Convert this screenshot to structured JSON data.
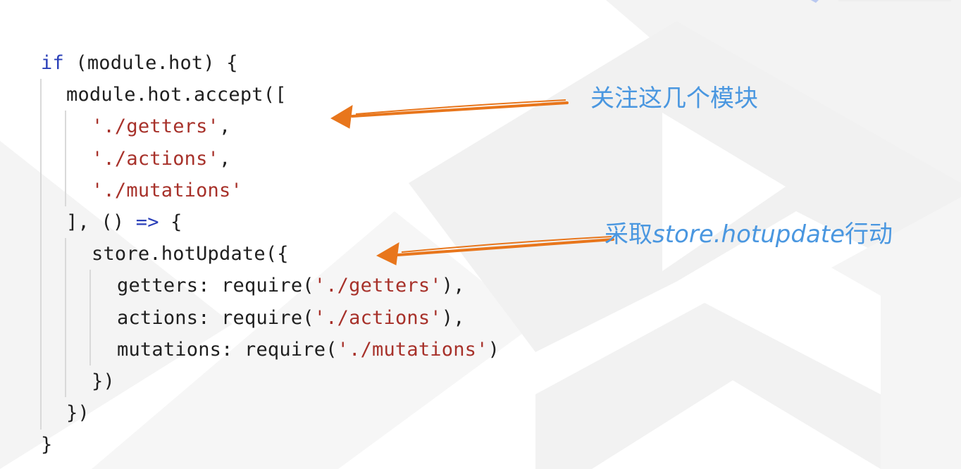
{
  "code": {
    "lines": [
      {
        "indent": 0,
        "tokens": [
          {
            "t": "if",
            "c": "kw"
          },
          {
            "t": " (module.hot) {",
            "c": ""
          }
        ]
      },
      {
        "indent": 1,
        "tokens": [
          {
            "t": "module.hot.accept([",
            "c": ""
          }
        ]
      },
      {
        "indent": 2,
        "tokens": [
          {
            "t": "'./getters'",
            "c": "str"
          },
          {
            "t": ",",
            "c": ""
          }
        ]
      },
      {
        "indent": 2,
        "tokens": [
          {
            "t": "'./actions'",
            "c": "str"
          },
          {
            "t": ",",
            "c": ""
          }
        ]
      },
      {
        "indent": 2,
        "tokens": [
          {
            "t": "'./mutations'",
            "c": "str"
          }
        ]
      },
      {
        "indent": 1,
        "tokens": [
          {
            "t": "], () ",
            "c": ""
          },
          {
            "t": "=>",
            "c": "kw"
          },
          {
            "t": " {",
            "c": ""
          }
        ]
      },
      {
        "indent": 2,
        "tokens": [
          {
            "t": "store.hotUpdate({",
            "c": ""
          }
        ]
      },
      {
        "indent": 3,
        "tokens": [
          {
            "t": "getters: require(",
            "c": ""
          },
          {
            "t": "'./getters'",
            "c": "str"
          },
          {
            "t": "),",
            "c": ""
          }
        ]
      },
      {
        "indent": 3,
        "tokens": [
          {
            "t": "actions: require(",
            "c": ""
          },
          {
            "t": "'./actions'",
            "c": "str"
          },
          {
            "t": "),",
            "c": ""
          }
        ]
      },
      {
        "indent": 3,
        "tokens": [
          {
            "t": "mutations: require(",
            "c": ""
          },
          {
            "t": "'./mutations'",
            "c": "str"
          },
          {
            "t": ")",
            "c": ""
          }
        ]
      },
      {
        "indent": 2,
        "tokens": [
          {
            "t": "})",
            "c": ""
          }
        ]
      },
      {
        "indent": 1,
        "tokens": [
          {
            "t": "})",
            "c": ""
          }
        ]
      },
      {
        "indent": 0,
        "tokens": [
          {
            "t": "}",
            "c": ""
          }
        ]
      }
    ]
  },
  "annotations": {
    "first": "关注这几个模块",
    "second_prefix": "采取",
    "second_code": "store.hotupdate",
    "second_suffix": "行动"
  },
  "colors": {
    "keyword": "#2a3fb8",
    "string": "#a7312a",
    "annotation": "#4a97e0",
    "arrow": "#e8761c"
  }
}
